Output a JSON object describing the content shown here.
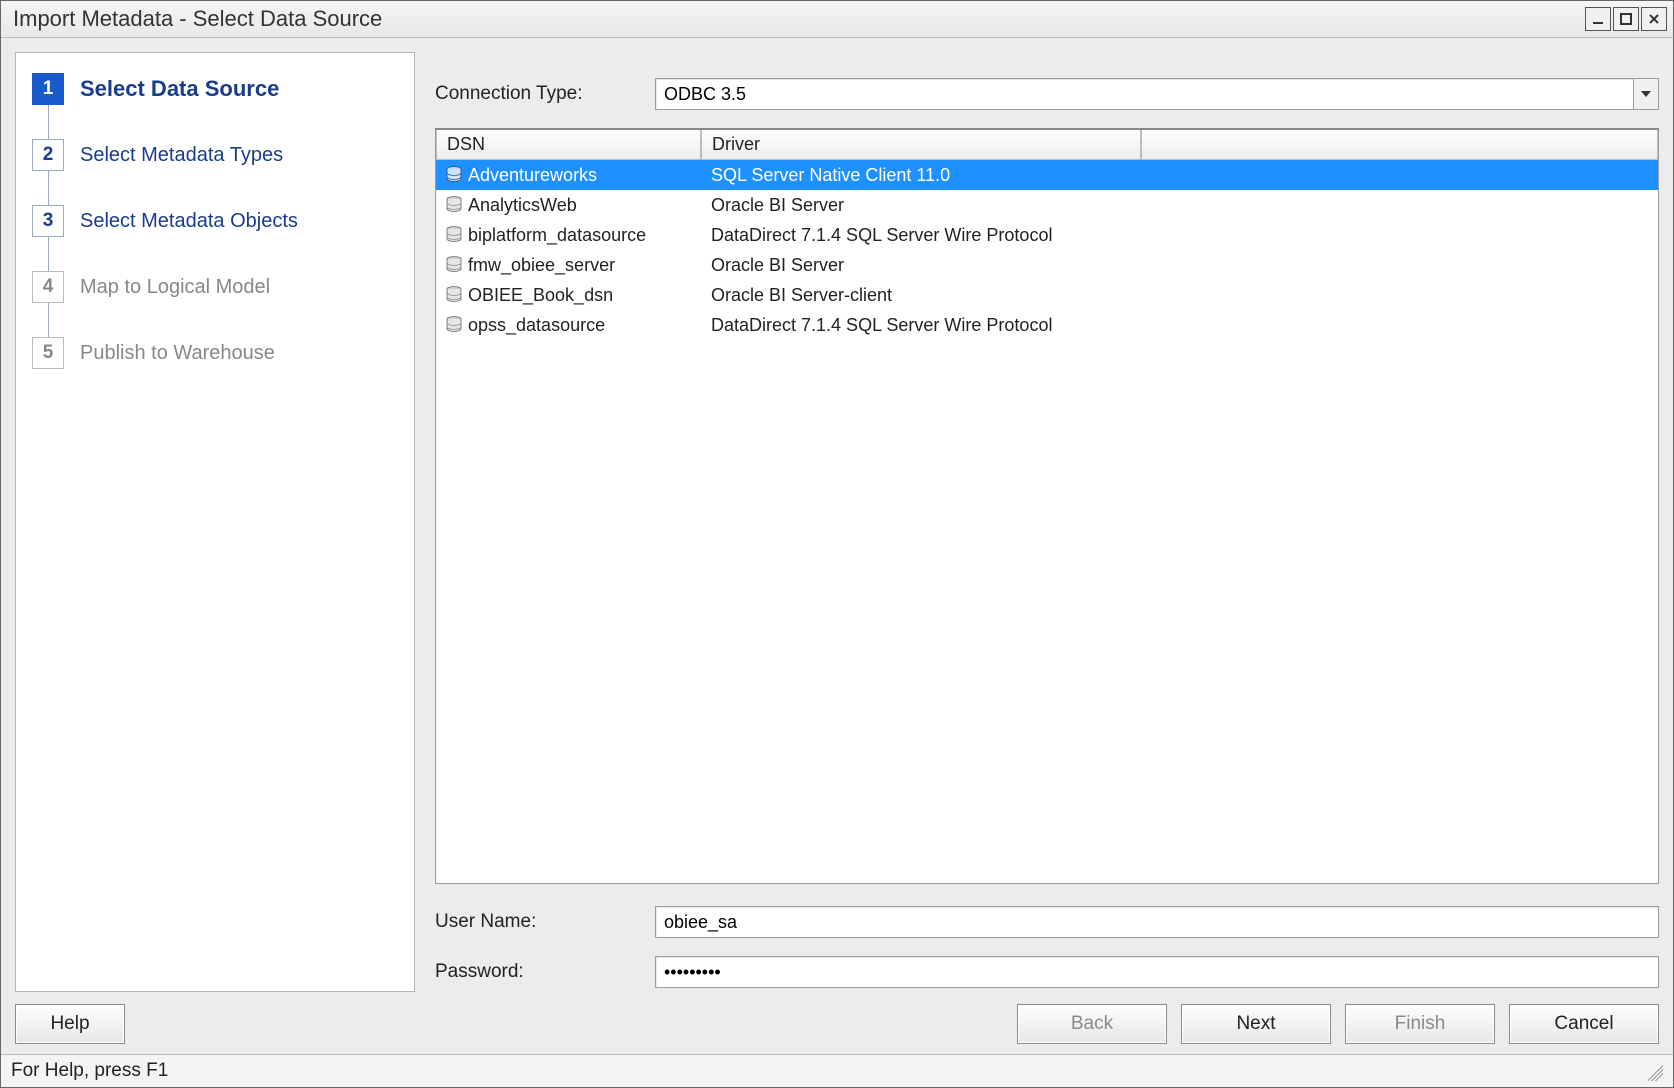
{
  "window": {
    "title": "Import Metadata - Select Data Source"
  },
  "wizard": {
    "steps": [
      {
        "num": "1",
        "label": "Select Data Source",
        "state": "current"
      },
      {
        "num": "2",
        "label": "Select Metadata Types",
        "state": "enabled"
      },
      {
        "num": "3",
        "label": "Select Metadata Objects",
        "state": "enabled"
      },
      {
        "num": "4",
        "label": "Map to Logical Model",
        "state": "disabled"
      },
      {
        "num": "5",
        "label": "Publish to Warehouse",
        "state": "disabled"
      }
    ]
  },
  "form": {
    "connection_type_label": "Connection Type:",
    "connection_type_value": "ODBC 3.5",
    "user_name_label": "User Name:",
    "user_name_value": "obiee_sa",
    "password_label": "Password:",
    "password_display": "•••••••••"
  },
  "list": {
    "columns": {
      "dsn": "DSN",
      "driver": "Driver"
    },
    "rows": [
      {
        "dsn": "Adventureworks",
        "driver": "SQL Server Native Client 11.0",
        "selected": true
      },
      {
        "dsn": "AnalyticsWeb",
        "driver": "Oracle BI Server",
        "selected": false
      },
      {
        "dsn": "biplatform_datasource",
        "driver": "DataDirect 7.1.4 SQL Server Wire Protocol",
        "selected": false
      },
      {
        "dsn": "fmw_obiee_server",
        "driver": "Oracle BI Server",
        "selected": false
      },
      {
        "dsn": "OBIEE_Book_dsn",
        "driver": "Oracle BI Server-client",
        "selected": false
      },
      {
        "dsn": "opss_datasource",
        "driver": "DataDirect 7.1.4 SQL Server Wire Protocol",
        "selected": false
      }
    ]
  },
  "buttons": {
    "help": "Help",
    "back": "Back",
    "next": "Next",
    "finish": "Finish",
    "cancel": "Cancel"
  },
  "status": {
    "text": "For Help, press F1"
  }
}
